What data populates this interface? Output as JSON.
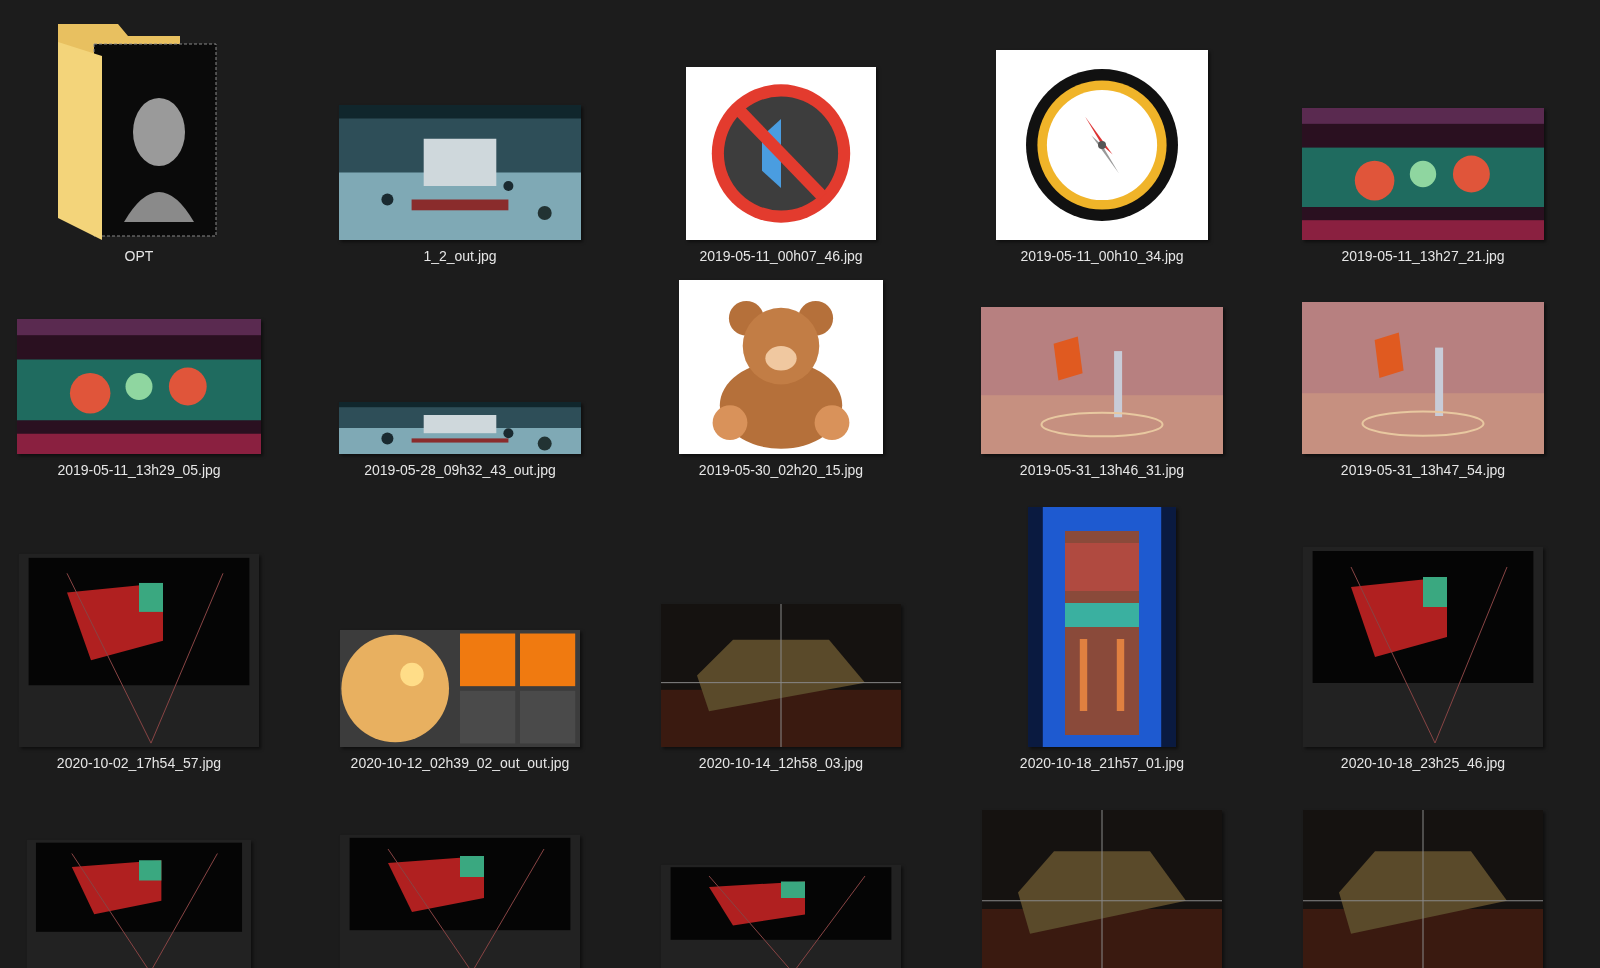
{
  "files": [
    {
      "kind": "folder",
      "name": "OPT"
    },
    {
      "kind": "picture",
      "name": "1_2_out.jpg"
    },
    {
      "kind": "picture",
      "name": "2019-05-11_00h07_46.jpg"
    },
    {
      "kind": "picture",
      "name": "2019-05-11_00h10_34.jpg"
    },
    {
      "kind": "picture",
      "name": "2019-05-11_13h27_21.jpg"
    },
    {
      "kind": "picture",
      "name": "2019-05-11_13h29_05.jpg"
    },
    {
      "kind": "picture",
      "name": "2019-05-28_09h32_43_out.jpg"
    },
    {
      "kind": "picture",
      "name": "2019-05-30_02h20_15.jpg"
    },
    {
      "kind": "picture",
      "name": "2019-05-31_13h46_31.jpg"
    },
    {
      "kind": "picture",
      "name": "2019-05-31_13h47_54.jpg"
    },
    {
      "kind": "picture",
      "name": "2020-10-02_17h54_57.jpg"
    },
    {
      "kind": "picture",
      "name": "2020-10-12_02h39_02_out_out.jpg"
    },
    {
      "kind": "picture",
      "name": "2020-10-14_12h58_03.jpg"
    },
    {
      "kind": "picture",
      "name": "2020-10-18_21h57_01.jpg"
    },
    {
      "kind": "picture",
      "name": "2020-10-18_23h25_46.jpg"
    },
    {
      "kind": "picture"
    },
    {
      "kind": "picture"
    },
    {
      "kind": "picture"
    },
    {
      "kind": "picture"
    },
    {
      "kind": "picture"
    }
  ]
}
